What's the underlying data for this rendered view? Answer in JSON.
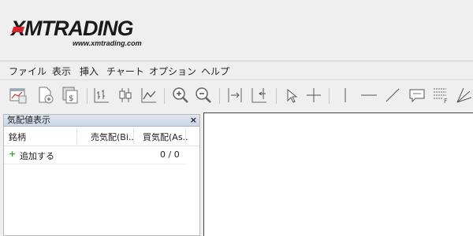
{
  "logo": {
    "wordmark": "XMTRADING",
    "url": "www.xmtrading.com",
    "accent_color": "#d8232a"
  },
  "menu": [
    "ファイル",
    "表示",
    "挿入",
    "チャート",
    "オプション",
    "ヘルプ"
  ],
  "toolbar": {
    "icons": [
      "new-chart-icon",
      "profiles-icon",
      "market-watch-icon",
      "bar-chart-icon",
      "candlestick-icon",
      "line-chart-icon",
      "zoom-in-icon",
      "zoom-out-icon",
      "chart-shift-icon",
      "autoscroll-icon",
      "cursor-icon",
      "crosshair-icon",
      "vertical-line-icon",
      "horizontal-line-icon",
      "trendline-icon",
      "text-label-icon",
      "fibonacci-icon",
      "gann-icon"
    ]
  },
  "market_watch": {
    "title": "気配値表示",
    "close": "×",
    "columns": [
      "銘柄",
      "売気配(Bi..",
      "買気配(As.."
    ],
    "rows": [
      {
        "symbol": "追加する",
        "count": "0 / 0"
      }
    ],
    "add_symbol_icon": "+"
  }
}
